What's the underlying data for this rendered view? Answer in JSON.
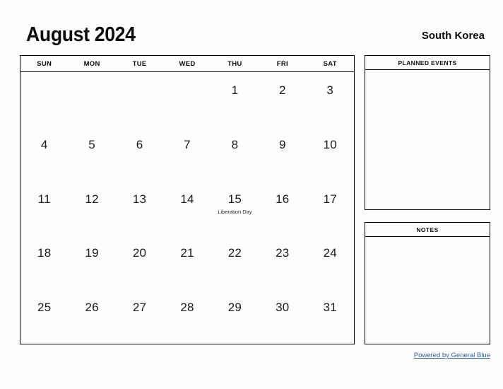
{
  "header": {
    "title": "August 2024",
    "region": "South Korea"
  },
  "calendar": {
    "month": "August",
    "year": "2024",
    "weekdays": [
      "SUN",
      "MON",
      "TUE",
      "WED",
      "THU",
      "FRI",
      "SAT"
    ],
    "weeks": [
      [
        {
          "day": ""
        },
        {
          "day": ""
        },
        {
          "day": ""
        },
        {
          "day": ""
        },
        {
          "day": "1"
        },
        {
          "day": "2"
        },
        {
          "day": "3"
        }
      ],
      [
        {
          "day": "4"
        },
        {
          "day": "5"
        },
        {
          "day": "6"
        },
        {
          "day": "7"
        },
        {
          "day": "8"
        },
        {
          "day": "9"
        },
        {
          "day": "10"
        }
      ],
      [
        {
          "day": "11"
        },
        {
          "day": "12"
        },
        {
          "day": "13"
        },
        {
          "day": "14"
        },
        {
          "day": "15",
          "event": "Liberation Day"
        },
        {
          "day": "16"
        },
        {
          "day": "17"
        }
      ],
      [
        {
          "day": "18"
        },
        {
          "day": "19"
        },
        {
          "day": "20"
        },
        {
          "day": "21"
        },
        {
          "day": "22"
        },
        {
          "day": "23"
        },
        {
          "day": "24"
        }
      ],
      [
        {
          "day": "25"
        },
        {
          "day": "26"
        },
        {
          "day": "27"
        },
        {
          "day": "28"
        },
        {
          "day": "29"
        },
        {
          "day": "30"
        },
        {
          "day": "31"
        }
      ]
    ]
  },
  "panels": {
    "planned_events": {
      "title": "PLANNED EVENTS",
      "content": ""
    },
    "notes": {
      "title": "NOTES",
      "content": ""
    }
  },
  "footer": {
    "link_text": "Powered by General Blue"
  },
  "colors": {
    "link": "#2a5db0",
    "border": "#000000",
    "text": "#111111",
    "background": "#fefefe"
  }
}
